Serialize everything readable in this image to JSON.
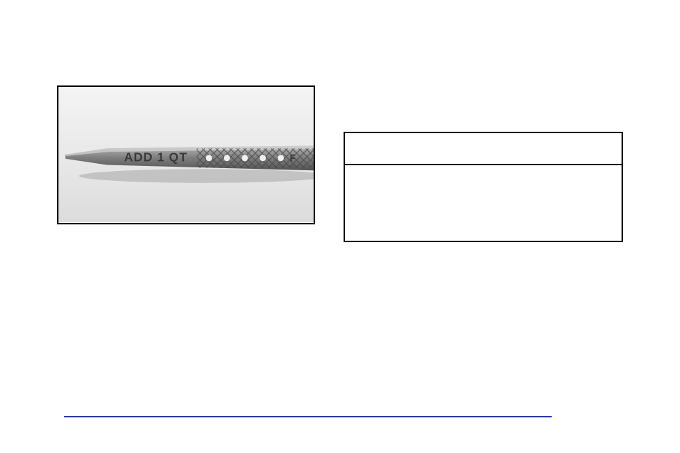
{
  "image": {
    "alt": "Close-up of engine oil dipstick tip with crosshatch pattern and level holes; engraving reads ADD 1 QT"
  },
  "table": {
    "header": "",
    "body": ""
  },
  "footer": {
    "source_line": ""
  }
}
